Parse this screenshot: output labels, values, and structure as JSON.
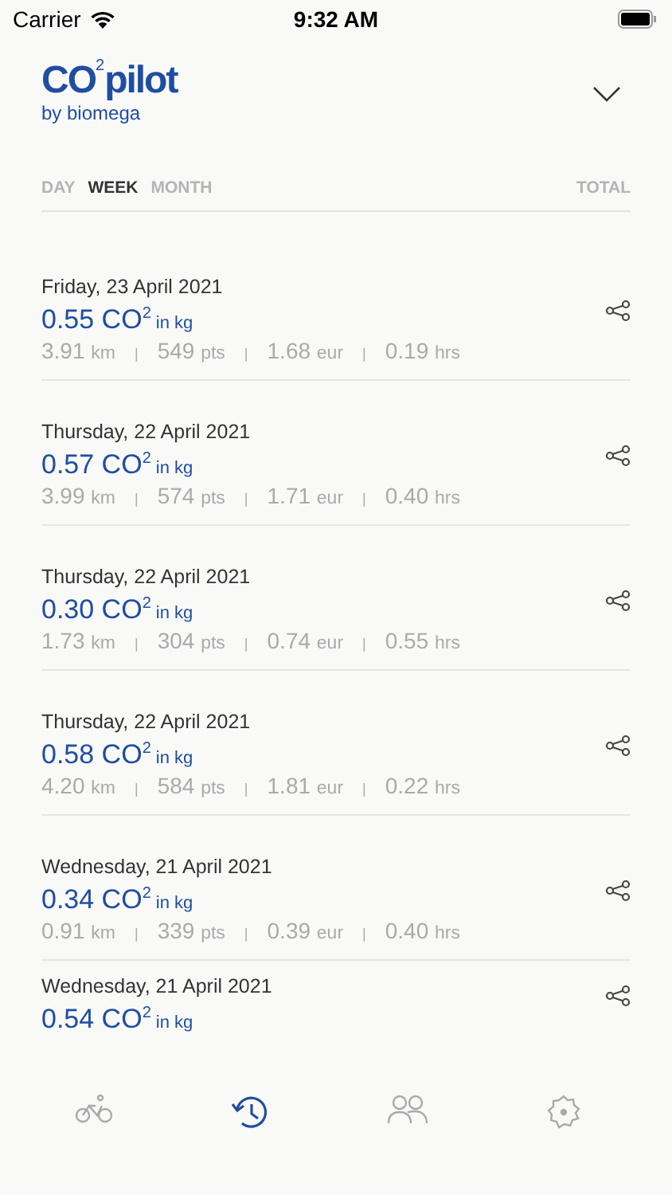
{
  "status_bar": {
    "carrier": "Carrier",
    "time": "9:32 AM"
  },
  "header": {
    "logo": "CO$^{2}$pilot",
    "subtitle": "by biomega",
    "menu_expanded": false
  },
  "tabs": [
    {
      "label": "DAY",
      "selected": false
    },
    {
      "label": "WEEK",
      "selected": true
    },
    {
      "label": "MONTH",
      "selected": false
    }
  ],
  "total": {
    "label": "TOTAL"
  },
  "trips": [
    {
      "date": "Friday, 23 April 2021",
      "co2": "0.55 CO$^{2}$",
      "co2_unit": "in kg",
      "stats": [
        {
          "value": "3.91",
          "unit": "km"
        },
        {
          "value": "549",
          "unit": "pts"
        },
        {
          "value": "1.68",
          "unit": "eur"
        },
        {
          "value": "0.19",
          "unit": "hrs"
        }
      ],
      "separators": [
        "|",
        "|",
        "|"
      ]
    },
    {
      "date": "Thursday, 22 April 2021",
      "co2": "0.57 CO$^{2}$",
      "co2_unit": "in kg",
      "stats": [
        {
          "value": "3.99",
          "unit": "km"
        },
        {
          "value": "574",
          "unit": "pts"
        },
        {
          "value": "1.71",
          "unit": "eur"
        },
        {
          "value": "0.40",
          "unit": "hrs"
        }
      ],
      "separators": [
        "|",
        "|",
        "|"
      ]
    },
    {
      "date": "Thursday, 22 April 2021",
      "co2": "0.30 CO$^{2}$",
      "co2_unit": "in kg",
      "stats": [
        {
          "value": "1.73",
          "unit": "km"
        },
        {
          "value": "304",
          "unit": "pts"
        },
        {
          "value": "0.74",
          "unit": "eur"
        },
        {
          "value": "0.55",
          "unit": "hrs"
        }
      ],
      "separators": [
        "|",
        "|",
        "|"
      ]
    },
    {
      "date": "Thursday, 22 April 2021",
      "co2": "0.58 CO$^{2}$",
      "co2_unit": "in kg",
      "stats": [
        {
          "value": "4.20",
          "unit": "km"
        },
        {
          "value": "584",
          "unit": "pts"
        },
        {
          "value": "1.81",
          "unit": "eur"
        },
        {
          "value": "0.22",
          "unit": "hrs"
        }
      ],
      "separators": [
        "|",
        "|",
        "|"
      ]
    },
    {
      "date": "Wednesday, 21 April 2021",
      "co2": "0.34 CO$^{2}$",
      "co2_unit": "in kg",
      "stats": [
        {
          "value": "0.91",
          "unit": "km"
        },
        {
          "value": "339",
          "unit": "pts"
        },
        {
          "value": "0.39",
          "unit": "eur"
        },
        {
          "value": "0.40",
          "unit": "hrs"
        }
      ],
      "separators": [
        "|",
        "|",
        "|"
      ]
    },
    {
      "date": "Wednesday, 21 April 2021",
      "co2": "0.54 CO$^{2}$",
      "co2_unit": "in kg"
    }
  ],
  "nav": [
    {
      "kind": "bike",
      "selected": false
    },
    {
      "kind": "history",
      "selected": true
    },
    {
      "kind": "people",
      "selected": false
    },
    {
      "kind": "settings",
      "selected": false
    }
  ]
}
